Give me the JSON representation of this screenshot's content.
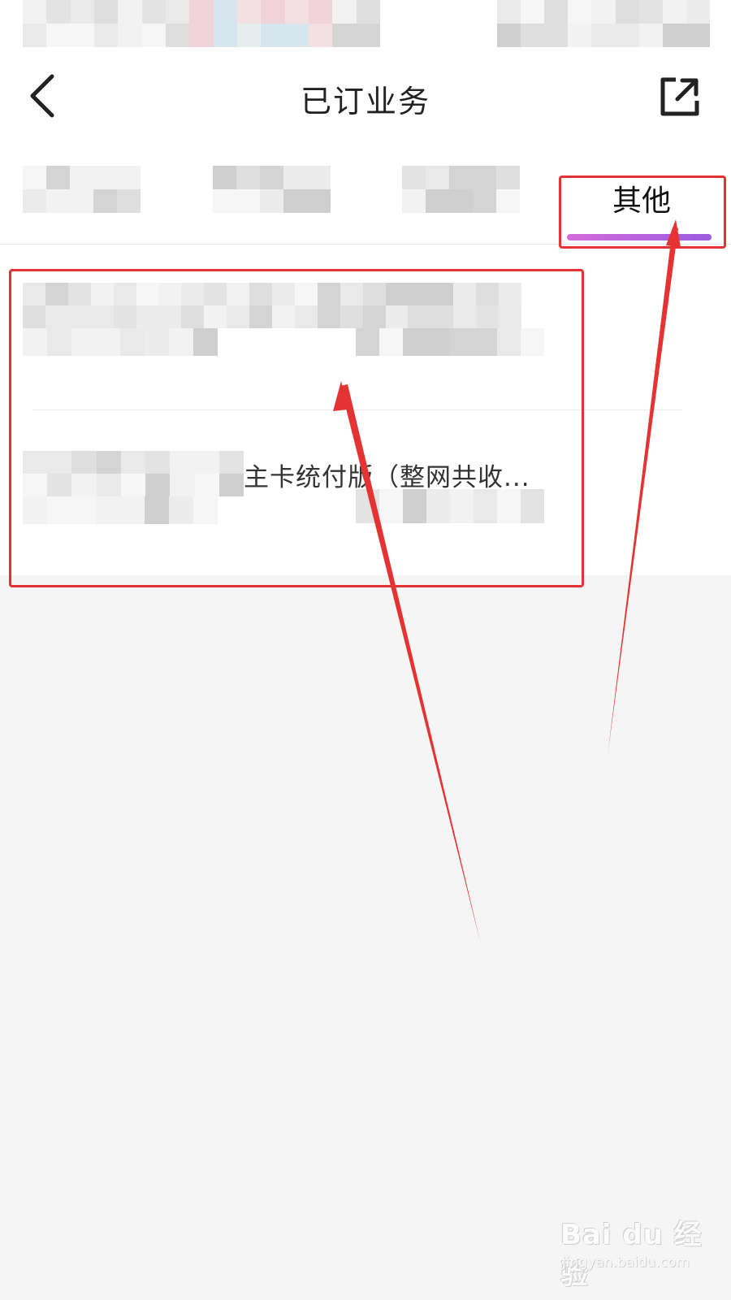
{
  "header": {
    "title": "已订业务",
    "back_icon": "chevron-left-icon",
    "share_icon": "share-external-icon"
  },
  "tabs": [
    {
      "label": "",
      "blurred": true
    },
    {
      "label": "",
      "blurred": true
    },
    {
      "label": "",
      "blurred": true
    },
    {
      "label": "其他",
      "selected": true
    }
  ],
  "services": [
    {
      "name": "",
      "blurred": true
    },
    {
      "name": "主卡统付版（整网共收..."
    }
  ],
  "colors": {
    "tab_indicator_start": "#d46bd9",
    "tab_indicator_end": "#9b5be0",
    "annotation_red": "#e53333",
    "page_background": "#f5f5f5"
  },
  "watermark": {
    "brand": "Bai du 经验",
    "url": "jingyan.baidu.com"
  }
}
